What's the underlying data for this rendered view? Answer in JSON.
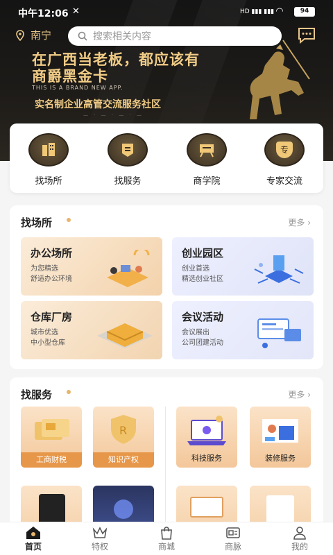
{
  "status": {
    "time": "中午12:06",
    "mute_icon": "mute-icon",
    "signal": "HD",
    "battery": "94"
  },
  "topbar": {
    "location": "南宁",
    "search_placeholder": "搜索相关内容"
  },
  "banner": {
    "line1": "在广西当老板，都应该有",
    "line2": "商爵黑金卡",
    "english": "THIS IS A BRAND NEW APP.",
    "line3": "实名制企业高管交流服务社区"
  },
  "quick": [
    {
      "label": "找场所",
      "icon": "building-icon"
    },
    {
      "label": "找服务",
      "icon": "service-icon"
    },
    {
      "label": "商学院",
      "icon": "school-icon"
    },
    {
      "label": "专家交流",
      "icon": "expert-icon",
      "glyph": "专"
    }
  ],
  "venues": {
    "title": "找场所",
    "more": "更多",
    "tiles": [
      {
        "title": "办公场所",
        "sub1": "为您精选",
        "sub2": "舒适办公环境"
      },
      {
        "title": "创业园区",
        "sub1": "创业首选",
        "sub2": "精选创业社区"
      },
      {
        "title": "仓库厂房",
        "sub1": "城市优选",
        "sub2": "中小型仓库"
      },
      {
        "title": "会议活动",
        "sub1": "会议展出",
        "sub2": "公司团建活动"
      }
    ]
  },
  "services": {
    "title": "找服务",
    "more": "更多",
    "items": [
      {
        "label": "工商财税"
      },
      {
        "label": "知识产权"
      },
      {
        "label": "科技服务"
      },
      {
        "label": "装修服务"
      }
    ]
  },
  "tabs": [
    {
      "label": "首页",
      "icon": "home-icon"
    },
    {
      "label": "特权",
      "icon": "crown-icon"
    },
    {
      "label": "商城",
      "icon": "shop-bag-icon"
    },
    {
      "label": "商脉",
      "icon": "contacts-card-icon"
    },
    {
      "label": "我的",
      "icon": "profile-icon"
    }
  ],
  "colors": {
    "gold": "#f1cc86",
    "accent": "#e8b56c",
    "dark": "#141414"
  }
}
